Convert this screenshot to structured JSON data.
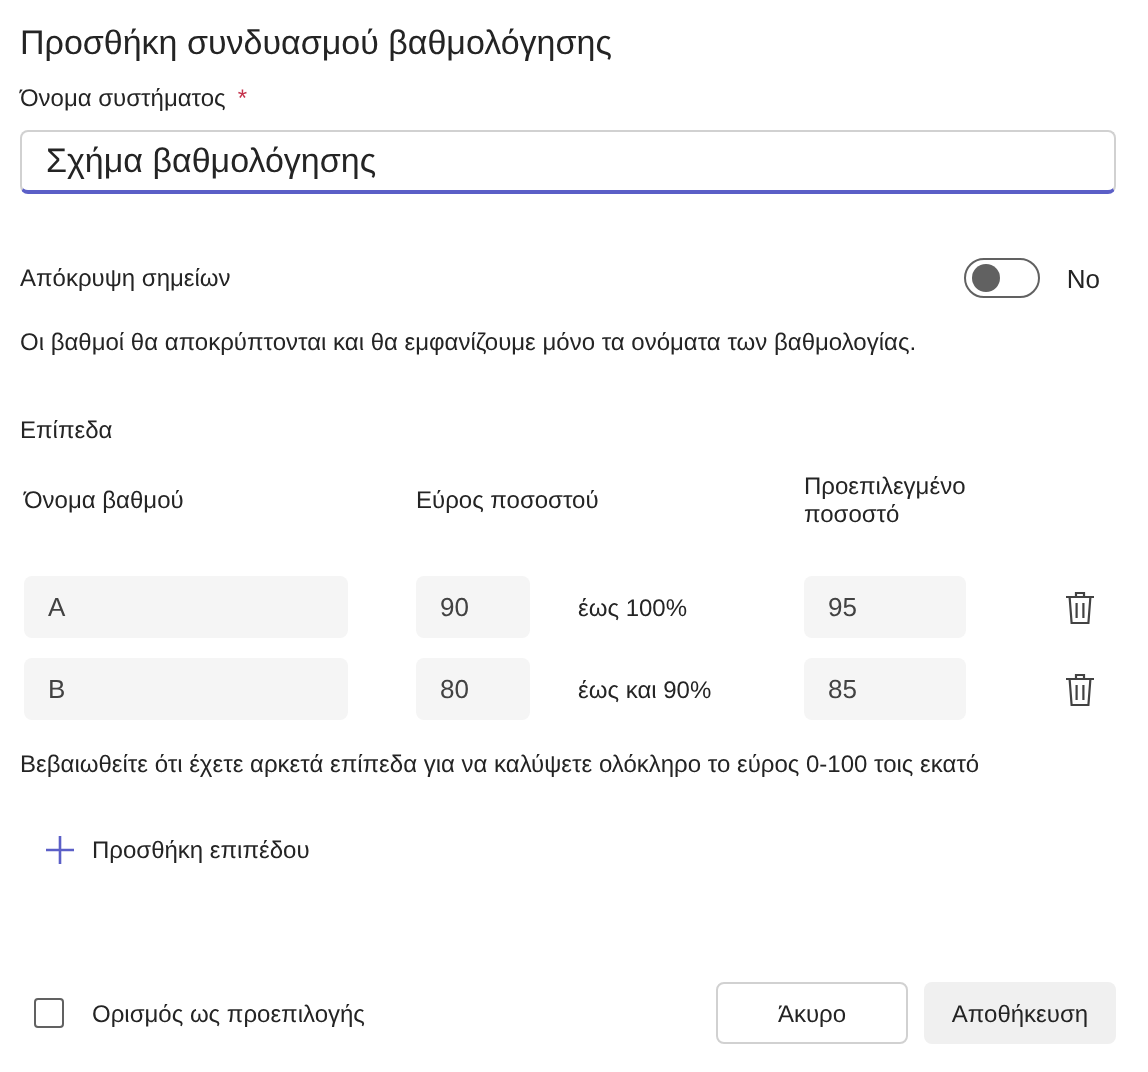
{
  "title": "Προσθήκη συνδυασμού βαθμολόγησης",
  "name_field": {
    "label": "Όνομα συστήματος",
    "required_mark": "*",
    "value": "Σχήμα βαθμολόγησης"
  },
  "hide_points": {
    "label": "Απόκρυψη σημείων",
    "on": false,
    "state_text": "No",
    "description": "Οι βαθμοί θα αποκρύπτονται και θα εμφανίζουμε μόνο τα ονόματα των βαθμολογίας."
  },
  "levels": {
    "heading": "Επίπεδα",
    "columns": [
      "Όνομα βαθμού",
      "Εύρος ποσοστού",
      "Προεπιλεγμένο ποσοστό"
    ],
    "rows": [
      {
        "name": "A",
        "min": "90",
        "range_text": "έως 100%",
        "default": "95"
      },
      {
        "name": "B",
        "min": "80",
        "range_text": "έως και 90%",
        "default": "85"
      }
    ],
    "note": "Βεβαιωθείτε ότι έχετε αρκετά επίπεδα για να καλύψετε ολόκληρο το εύρος 0-100 τοις εκατό",
    "add_button": "Προσθήκη επιπέδου"
  },
  "footer": {
    "default_checkbox": {
      "label": "Ορισμός ως προεπιλογής",
      "checked": false
    },
    "buttons": [
      {
        "label": "Άκυρο",
        "kind": "secondary",
        "disabled": false
      },
      {
        "label": "Αποθήκευση",
        "kind": "primary",
        "disabled": true
      }
    ]
  }
}
